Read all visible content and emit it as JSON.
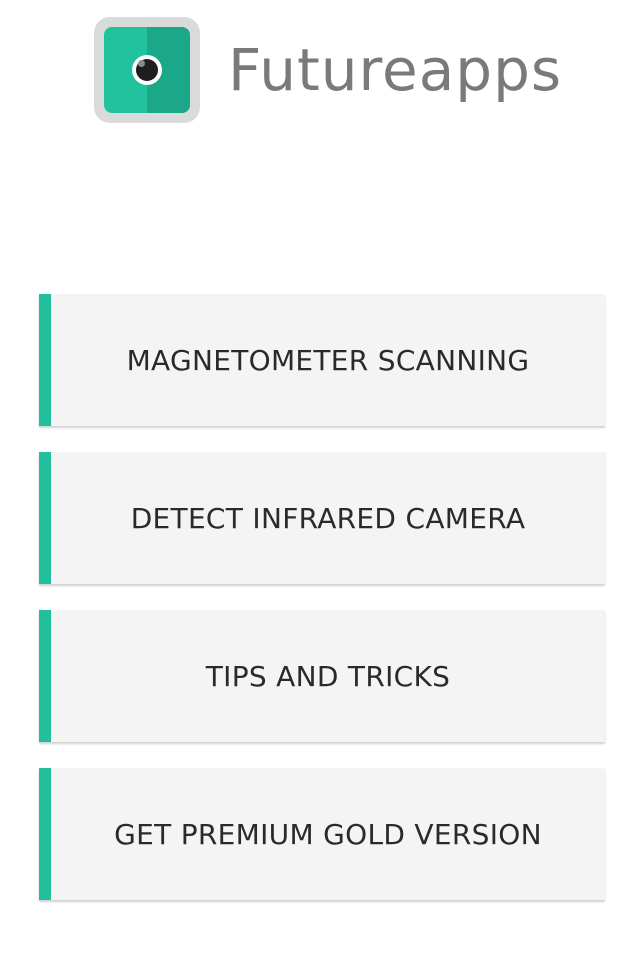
{
  "app": {
    "brand_name": "Futureapps",
    "logo_icon": "camera-lens-icon",
    "accent_color": "#22bf9c"
  },
  "menu": {
    "items": [
      {
        "label": "MAGNETOMETER SCANNING"
      },
      {
        "label": "DETECT INFRARED CAMERA"
      },
      {
        "label": "TIPS AND TRICKS"
      },
      {
        "label": "GET PREMIUM GOLD VERSION"
      }
    ]
  }
}
